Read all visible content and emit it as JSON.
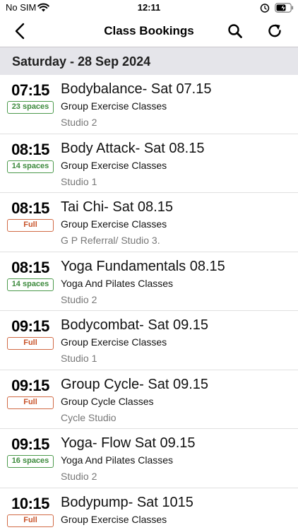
{
  "status_bar": {
    "carrier": "No SIM",
    "time": "12:11",
    "icons": [
      "wifi-icon",
      "alarm-icon",
      "battery-charging-icon"
    ]
  },
  "nav": {
    "title": "Class Bookings",
    "icons": [
      "chevron-left-icon",
      "search-icon",
      "refresh-icon"
    ]
  },
  "section": {
    "date": "Saturday - 28 Sep 2024"
  },
  "colors": {
    "available": "#4c9a4c",
    "full": "#d16a45",
    "section_bg": "#e5e5ea"
  },
  "classes": [
    {
      "time": "07:15",
      "availability": "23 spaces",
      "status": "spaces",
      "name": "Bodybalance- Sat 07.15",
      "category": "Group Exercise Classes",
      "location": "Studio 2"
    },
    {
      "time": "08:15",
      "availability": "14 spaces",
      "status": "spaces",
      "name": "Body Attack- Sat 08.15",
      "category": "Group Exercise Classes",
      "location": "Studio 1"
    },
    {
      "time": "08:15",
      "availability": "Full",
      "status": "full",
      "name": "Tai Chi- Sat 08.15",
      "category": "Group Exercise Classes",
      "location": "G P Referral/ Studio 3."
    },
    {
      "time": "08:15",
      "availability": "14 spaces",
      "status": "spaces",
      "name": "Yoga Fundamentals 08.15",
      "category": "Yoga And Pilates Classes",
      "location": "Studio 2"
    },
    {
      "time": "09:15",
      "availability": "Full",
      "status": "full",
      "name": "Bodycombat-  Sat 09.15",
      "category": "Group Exercise Classes",
      "location": "Studio 1"
    },
    {
      "time": "09:15",
      "availability": "Full",
      "status": "full",
      "name": "Group Cycle- Sat 09.15",
      "category": "Group Cycle Classes",
      "location": "Cycle Studio"
    },
    {
      "time": "09:15",
      "availability": "16 spaces",
      "status": "spaces",
      "name": "Yoga- Flow Sat 09.15",
      "category": "Yoga And Pilates Classes",
      "location": "Studio 2"
    },
    {
      "time": "10:15",
      "availability": "Full",
      "status": "full",
      "name": "Bodypump- Sat 1015",
      "category": "Group Exercise Classes",
      "location": ""
    }
  ]
}
